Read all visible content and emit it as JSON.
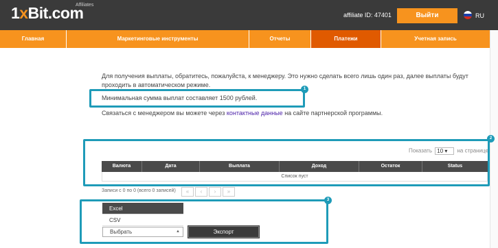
{
  "header": {
    "logo_main": "1xBit.com",
    "logo_prefix": "1",
    "logo_x": "x",
    "logo_rest": "Bit.com",
    "logo_sub": "Affiliates",
    "affiliate_id": "affiliate ID: 47401",
    "login_label": "Выйти",
    "language": "RU",
    "flag_colors": [
      "#ffffff",
      "#1c3fa8",
      "#d52b1e"
    ]
  },
  "nav": {
    "items": [
      {
        "label": "Главная",
        "active": false
      },
      {
        "label": "Маркетинговые инструменты",
        "active": false
      },
      {
        "label": "Отчеты",
        "active": false
      },
      {
        "label": "Платежи",
        "active": true
      },
      {
        "label": "Учетная запись",
        "active": false
      }
    ]
  },
  "content": {
    "intro": "Для получения выплаты, обратитесь, пожалуйста, к менеджеру. Это нужно сделать всего лишь один раз, далее выплаты будут проходить в автоматическом режиме.",
    "min_sum": "Минимальная сумма выплат составляет 1500 рублей.",
    "contact_before": "Связаться с менеджером вы можете через ",
    "contact_link": "контактные данные",
    "contact_after": " на сайте партнерской программы."
  },
  "table": {
    "show_label": "Показать",
    "page_size": "10",
    "per_page_label": "на странице",
    "columns": [
      "Валюта",
      "Дата",
      "Выплата",
      "Доход",
      "Остаток",
      "Status"
    ],
    "empty_text": "Список пуст",
    "records_info": "Записи с 0 по 0 (всего 0 записей)",
    "pager": [
      "«",
      "‹",
      "›",
      "»"
    ]
  },
  "export": {
    "options": [
      "Excel",
      "CSV"
    ],
    "selected_option": "Excel",
    "select_label": "Выбрать",
    "button_label": "Экспорт"
  },
  "annotations": {
    "badges": [
      "1",
      "2",
      "3"
    ],
    "color": "#1e9bb8"
  },
  "colors": {
    "brand_orange": "#f7931e",
    "active_tab": "#e05a00",
    "header_dark": "#3a3a3a"
  }
}
